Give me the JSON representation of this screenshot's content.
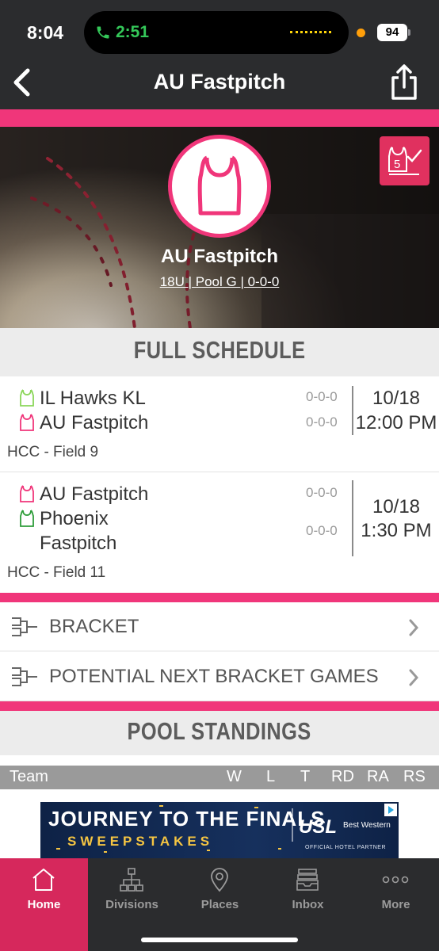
{
  "status_bar": {
    "time": "8:04",
    "call_timer": "2:51",
    "battery": "94"
  },
  "header": {
    "title": "AU Fastpitch"
  },
  "hero": {
    "team_name": "AU Fastpitch",
    "subtitle": "18U | Pool G | 0-0-0",
    "checkin_number": "5"
  },
  "schedule": {
    "title": "FULL SCHEDULE",
    "games": [
      {
        "teams": [
          {
            "name": "IL Hawks KL",
            "record": "0-0-0",
            "jersey_color": "#8bd65a"
          },
          {
            "name": "AU Fastpitch",
            "record": "0-0-0",
            "jersey_color": "#f0367a"
          }
        ],
        "date": "10/18",
        "time": "12:00 PM",
        "location": "HCC - Field 9"
      },
      {
        "teams": [
          {
            "name": "AU Fastpitch",
            "record": "0-0-0",
            "jersey_color": "#f0367a"
          },
          {
            "name": "Phoenix",
            "name2": "Fastpitch",
            "record": "0-0-0",
            "jersey_color": "#2e9d3a"
          }
        ],
        "date": "10/18",
        "time": "1:30 PM",
        "location": "HCC - Field 11"
      }
    ]
  },
  "links": {
    "bracket": "BRACKET",
    "potential": "POTENTIAL NEXT BRACKET GAMES"
  },
  "standings": {
    "title": "POOL STANDINGS",
    "columns": [
      "Team",
      "W",
      "L",
      "T",
      "RD",
      "RA",
      "RS"
    ]
  },
  "ad": {
    "line1": "JOURNEY TO THE FINALS",
    "line2": "SWEEPSTAKES",
    "brand": "USL",
    "partner_brand": "Best Western",
    "partner_caption": "OFFICIAL HOTEL PARTNER"
  },
  "tabs": [
    {
      "label": "Home",
      "icon": "home-icon",
      "active": true
    },
    {
      "label": "Divisions",
      "icon": "hierarchy-icon"
    },
    {
      "label": "Places",
      "icon": "map-pin-icon"
    },
    {
      "label": "Inbox",
      "icon": "inbox-icon"
    },
    {
      "label": "More",
      "icon": "more-icon"
    }
  ],
  "colors": {
    "accent": "#f0367a",
    "header": "#2b2c2e",
    "active_tab": "#d6285c"
  }
}
